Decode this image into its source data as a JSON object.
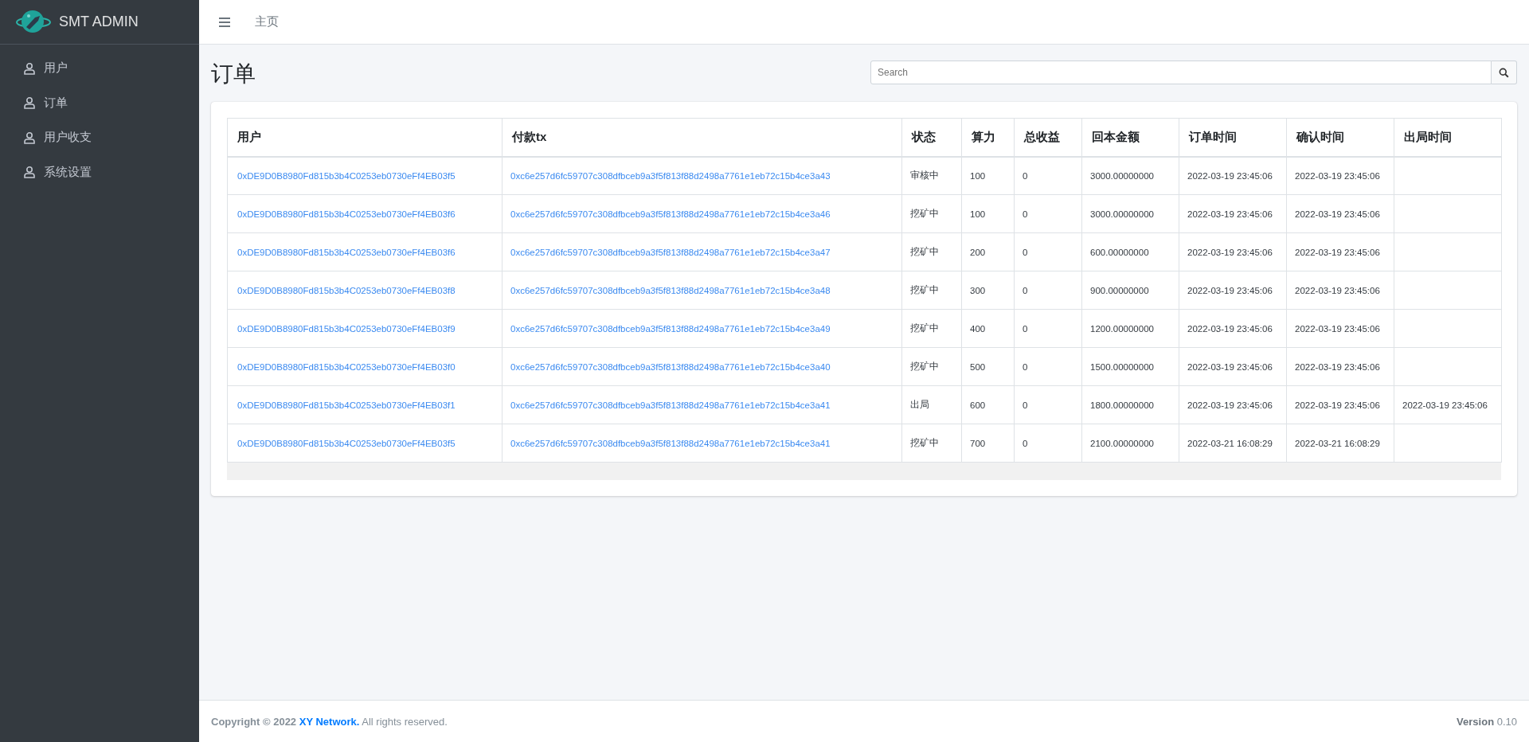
{
  "brand": {
    "name": "SMT ADMIN"
  },
  "sidebar": {
    "items": [
      {
        "label": "用户"
      },
      {
        "label": "订单"
      },
      {
        "label": "用户收支"
      },
      {
        "label": "系统设置"
      }
    ]
  },
  "header": {
    "breadcrumb": "主页"
  },
  "page": {
    "title": "订单",
    "search": {
      "placeholder": "Search"
    }
  },
  "table": {
    "columns": [
      "用户",
      "付款tx",
      "状态",
      "算力",
      "总收益",
      "回本金额",
      "订单时间",
      "确认时间",
      "出局时间"
    ],
    "rows": [
      [
        "0xDE9D0B8980Fd815b3b4C0253eb0730eFf4EB03f5",
        "0xc6e257d6fc59707c308dfbceb9a3f5f813f88d2498a7761e1eb72c15b4ce3a43",
        "审核中",
        "100",
        "0",
        "3000.00000000",
        "2022-03-19 23:45:06",
        "2022-03-19 23:45:06",
        ""
      ],
      [
        "0xDE9D0B8980Fd815b3b4C0253eb0730eFf4EB03f6",
        "0xc6e257d6fc59707c308dfbceb9a3f5f813f88d2498a7761e1eb72c15b4ce3a46",
        "挖矿中",
        "100",
        "0",
        "3000.00000000",
        "2022-03-19 23:45:06",
        "2022-03-19 23:45:06",
        ""
      ],
      [
        "0xDE9D0B8980Fd815b3b4C0253eb0730eFf4EB03f6",
        "0xc6e257d6fc59707c308dfbceb9a3f5f813f88d2498a7761e1eb72c15b4ce3a47",
        "挖矿中",
        "200",
        "0",
        "600.00000000",
        "2022-03-19 23:45:06",
        "2022-03-19 23:45:06",
        ""
      ],
      [
        "0xDE9D0B8980Fd815b3b4C0253eb0730eFf4EB03f8",
        "0xc6e257d6fc59707c308dfbceb9a3f5f813f88d2498a7761e1eb72c15b4ce3a48",
        "挖矿中",
        "300",
        "0",
        "900.00000000",
        "2022-03-19 23:45:06",
        "2022-03-19 23:45:06",
        ""
      ],
      [
        "0xDE9D0B8980Fd815b3b4C0253eb0730eFf4EB03f9",
        "0xc6e257d6fc59707c308dfbceb9a3f5f813f88d2498a7761e1eb72c15b4ce3a49",
        "挖矿中",
        "400",
        "0",
        "1200.00000000",
        "2022-03-19 23:45:06",
        "2022-03-19 23:45:06",
        ""
      ],
      [
        "0xDE9D0B8980Fd815b3b4C0253eb0730eFf4EB03f0",
        "0xc6e257d6fc59707c308dfbceb9a3f5f813f88d2498a7761e1eb72c15b4ce3a40",
        "挖矿中",
        "500",
        "0",
        "1500.00000000",
        "2022-03-19 23:45:06",
        "2022-03-19 23:45:06",
        ""
      ],
      [
        "0xDE9D0B8980Fd815b3b4C0253eb0730eFf4EB03f1",
        "0xc6e257d6fc59707c308dfbceb9a3f5f813f88d2498a7761e1eb72c15b4ce3a41",
        "出局",
        "600",
        "0",
        "1800.00000000",
        "2022-03-19 23:45:06",
        "2022-03-19 23:45:06",
        "2022-03-19 23:45:06"
      ],
      [
        "0xDE9D0B8980Fd815b3b4C0253eb0730eFf4EB03f5",
        "0xc6e257d6fc59707c308dfbceb9a3f5f813f88d2498a7761e1eb72c15b4ce3a41",
        "挖矿中",
        "700",
        "0",
        "2100.00000000",
        "2022-03-21 16:08:29",
        "2022-03-21 16:08:29",
        ""
      ]
    ]
  },
  "footer": {
    "copyright": "Copyright © 2022",
    "company": "XY Network.",
    "rights": "All rights reserved.",
    "version_label": "Version",
    "version": "0.10"
  }
}
